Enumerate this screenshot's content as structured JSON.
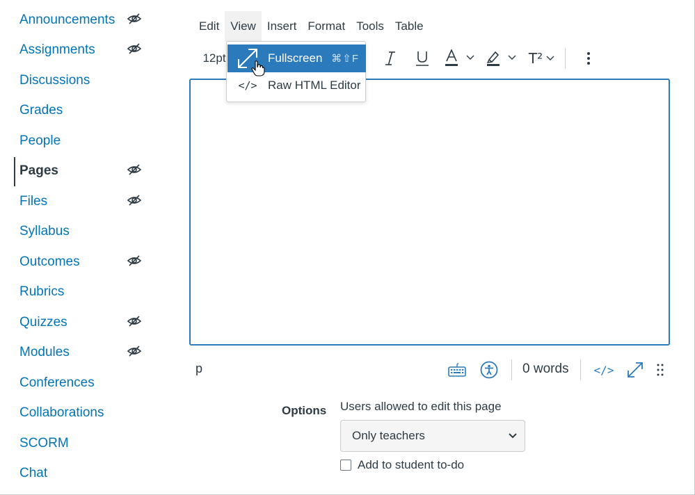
{
  "sidebar": {
    "items": [
      {
        "label": "Announcements",
        "hidden": true
      },
      {
        "label": "Assignments",
        "hidden": true
      },
      {
        "label": "Discussions",
        "hidden": false
      },
      {
        "label": "Grades",
        "hidden": false
      },
      {
        "label": "People",
        "hidden": false
      },
      {
        "label": "Pages",
        "hidden": true,
        "active": true
      },
      {
        "label": "Files",
        "hidden": true
      },
      {
        "label": "Syllabus",
        "hidden": false
      },
      {
        "label": "Outcomes",
        "hidden": true
      },
      {
        "label": "Rubrics",
        "hidden": false
      },
      {
        "label": "Quizzes",
        "hidden": true
      },
      {
        "label": "Modules",
        "hidden": true
      },
      {
        "label": "Conferences",
        "hidden": false
      },
      {
        "label": "Collaborations",
        "hidden": false
      },
      {
        "label": "SCORM",
        "hidden": false
      },
      {
        "label": "Chat",
        "hidden": false
      }
    ]
  },
  "menubar": {
    "items": [
      "Edit",
      "View",
      "Insert",
      "Format",
      "Tools",
      "Table"
    ],
    "open_menu": "View"
  },
  "toolbar": {
    "font_size": "12pt",
    "superscript_label": "T²",
    "icons": [
      "italic-icon",
      "underline-icon",
      "text-color-icon",
      "highlight-icon",
      "superscript-icon",
      "more-icon"
    ]
  },
  "view_menu": {
    "items": [
      {
        "label": "Fullscreen",
        "shortcut": "⌘⇧F",
        "icon": "fullscreen-icon",
        "active": true
      },
      {
        "label": "Raw HTML Editor",
        "icon_text": "</>",
        "icon": "code-icon",
        "active": false
      }
    ]
  },
  "statusbar": {
    "path": "p",
    "word_count": "0 words",
    "html_toggle": "</>"
  },
  "options": {
    "label": "Options",
    "edit_permission_label": "Users allowed to edit this page",
    "edit_permission_value": "Only teachers",
    "todo_label": "Add to student to-do",
    "todo_checked": false
  },
  "colors": {
    "link": "#0374b5",
    "accent": "#2b7abc",
    "text": "#2d3b45",
    "border": "#c7cdd1"
  }
}
